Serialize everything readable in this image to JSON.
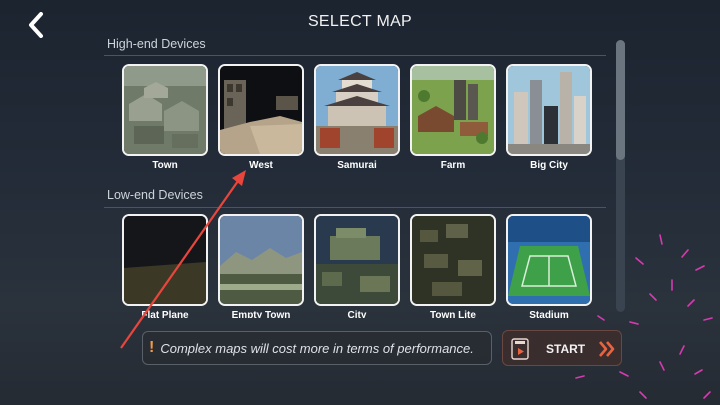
{
  "header": {
    "title": "SELECT MAP",
    "back_icon": "chevron-left-icon"
  },
  "sections": [
    {
      "label": "High-end Devices",
      "maps": [
        {
          "name": "Town"
        },
        {
          "name": "West"
        },
        {
          "name": "Samurai"
        },
        {
          "name": "Farm"
        },
        {
          "name": "Big City"
        }
      ]
    },
    {
      "label": "Low-end Devices",
      "maps": [
        {
          "name": "Flat Plane"
        },
        {
          "name": "Empty Town"
        },
        {
          "name": "City"
        },
        {
          "name": "Town Lite"
        },
        {
          "name": "Stadium"
        }
      ]
    }
  ],
  "footer": {
    "warning_icon": "exclamation-icon",
    "warning_text": "Complex maps will cost more in terms of performance.",
    "start_label": "START",
    "start_icons": [
      "video-ad-icon",
      "double-chevron-right-icon"
    ]
  },
  "colors": {
    "accent": "#e8633f",
    "warning": "#f39a45",
    "annotation_arrow": "#e8463c",
    "section_line": "#3f5872"
  }
}
